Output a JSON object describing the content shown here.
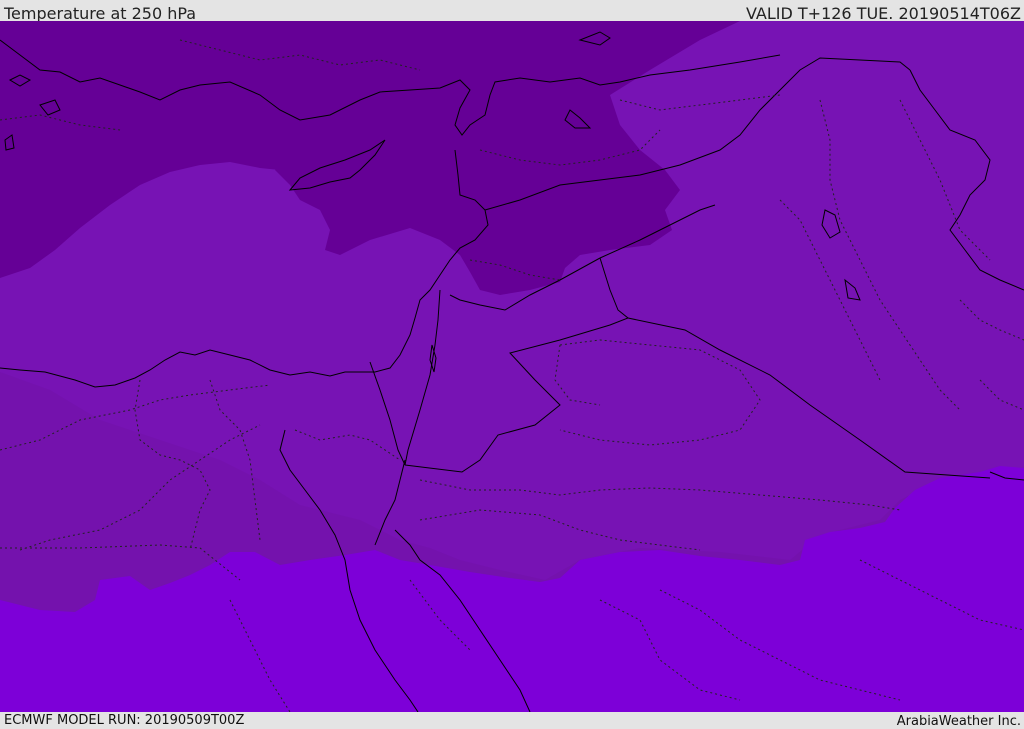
{
  "header": {
    "title": "Temperature at 250 hPa",
    "valid_time": "VALID T+126 TUE. 20190514T06Z"
  },
  "footer": {
    "model_run": "ECMWF MODEL RUN: 20190509T00Z",
    "brand": "ArabiaWeather Inc."
  },
  "map": {
    "field": "temperature",
    "level": "250 hPa",
    "colors": {
      "coldest_zone": "#650096",
      "cold_zone": "#7612b2",
      "mid_zone": "#7411ac",
      "warm_zone": "#7d00d8",
      "coastline": "#000000",
      "borders": "#000000"
    }
  }
}
